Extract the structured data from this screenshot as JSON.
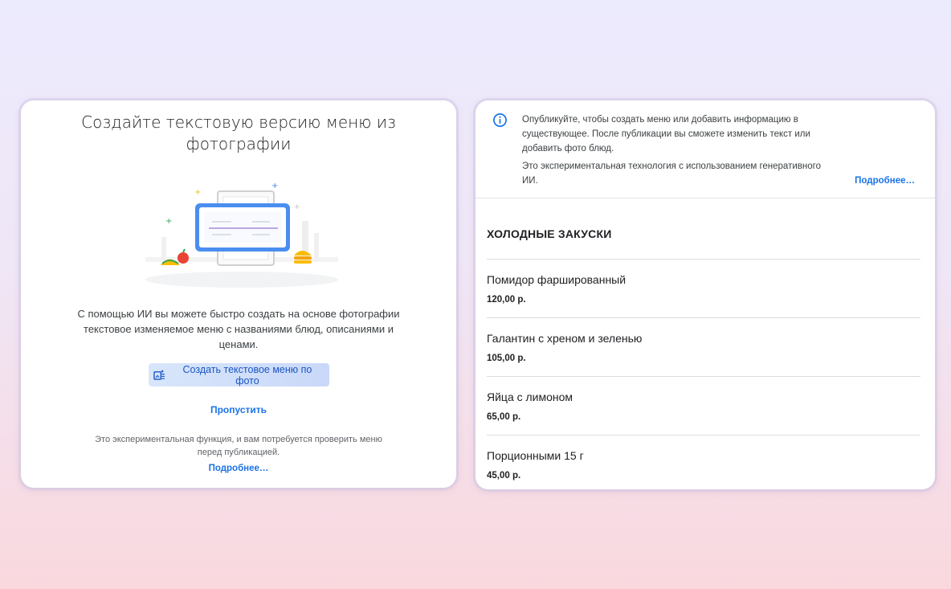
{
  "left_card": {
    "title": "Создайте текстовую версию меню из фотографии",
    "description": "С помощью ИИ вы можете быстро создать на основе фотографии текстовое изменяемое меню с названиями блюд, описаниями и ценами.",
    "create_button_label": "Создать текстовое меню по фото",
    "skip_label": "Пропустить",
    "note": "Это экспериментальная функция, и вам потребуется проверить меню перед публикацией.",
    "more_label": "Подробнее…"
  },
  "right_card": {
    "info_text": "Опубликуйте, чтобы создать меню или добавить информацию в существующее. После публикации вы сможете изменить текст или добавить фото блюд.",
    "info_text2": "Это экспериментальная технология с использованием генеративного ИИ.",
    "more_label": "Подробнее…",
    "section_title": "ХОЛОДНЫЕ ЗАКУСКИ",
    "items": [
      {
        "name": "Помидор фаршированный",
        "price": "120,00 р."
      },
      {
        "name": "Галантин с хреном и зеленью",
        "price": "105,00 р."
      },
      {
        "name": "Яйца с лимоном",
        "price": "65,00 р."
      },
      {
        "name": "Порционными 15 г",
        "price": "45,00 р."
      }
    ]
  },
  "colors": {
    "accent": "#1a73e8",
    "button_bg": "#d2e3fc"
  },
  "icons": {
    "create_button_icon": "photo-to-text-icon",
    "info_icon": "info-icon"
  }
}
